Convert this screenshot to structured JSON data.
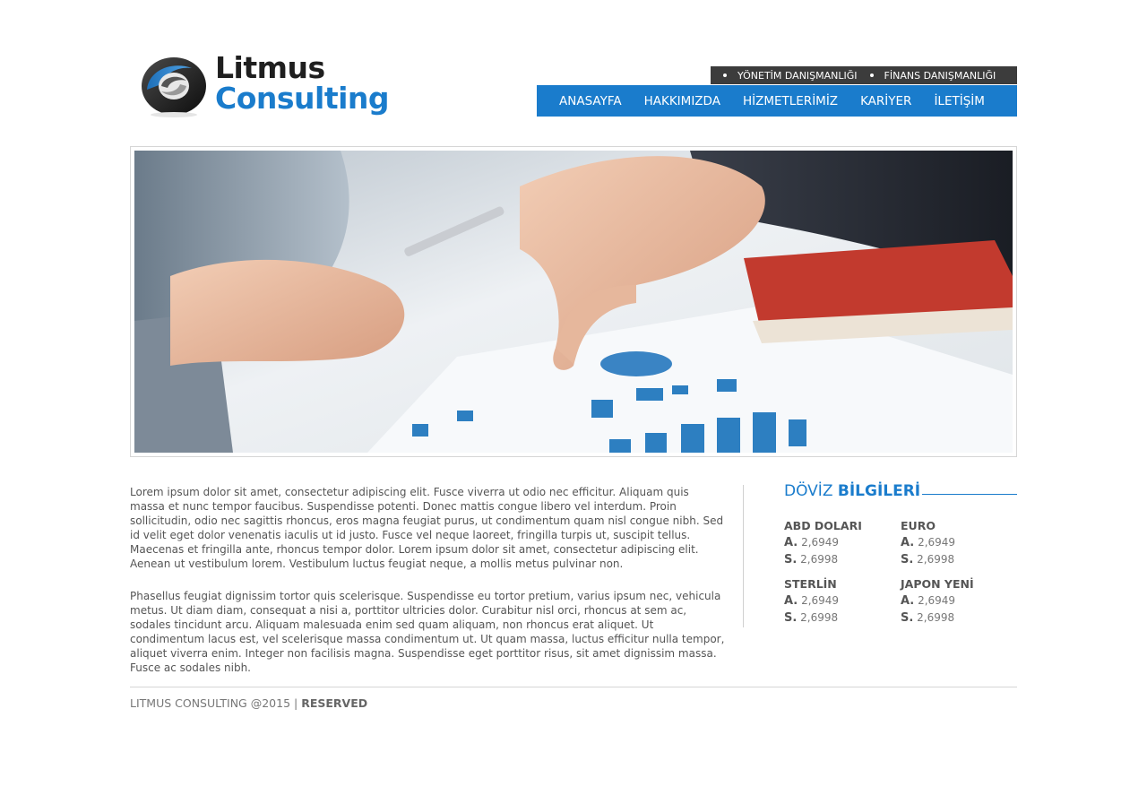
{
  "brand": {
    "line1": "Litmus",
    "line2": "Consulting",
    "colors": {
      "primary": "#1a7ccc",
      "dark": "#3c3c3c"
    }
  },
  "subnav": {
    "items": [
      {
        "label": "YÖNETİM DANIŞMANLIĞI"
      },
      {
        "label": "FİNANS DANIŞMANLIĞI"
      }
    ]
  },
  "mainnav": {
    "items": [
      {
        "label": "ANASAYFA"
      },
      {
        "label": "HAKKIMIZDA"
      },
      {
        "label": "HİZMETLERİMİZ"
      },
      {
        "label": "KARİYER"
      },
      {
        "label": "İLETİŞİM"
      }
    ]
  },
  "content": {
    "paragraphs": [
      "Lorem ipsum dolor sit amet, consectetur adipiscing elit. Fusce viverra ut odio nec efficitur. Aliquam quis massa et nunc tempor faucibus. Suspendisse potenti. Donec mattis congue libero vel interdum. Proin sollicitudin, odio nec sagittis rhoncus, eros magna feugiat purus, ut condimentum quam nisl congue nibh. Sed id velit eget dolor venenatis iaculis ut id justo. Fusce vel neque laoreet, fringilla turpis ut, suscipit tellus. Maecenas et fringilla ante, rhoncus tempor dolor. Lorem ipsum dolor sit amet, consectetur adipiscing elit. Aenean ut vestibulum lorem. Vestibulum luctus feugiat neque, a mollis metus pulvinar non.",
      "Phasellus feugiat dignissim tortor quis scelerisque. Suspendisse eu tortor pretium, varius ipsum nec, vehicula metus. Ut diam diam, consequat a nisi a, porttitor ultricies dolor. Curabitur nisl orci, rhoncus at sem ac, sodales tincidunt arcu. Aliquam malesuada enim sed quam aliquam, non rhoncus erat aliquet. Ut condimentum lacus est, vel scelerisque massa condimentum ut. Ut quam massa, luctus efficitur nulla tempor, aliquet viverra enim. Integer non facilisis magna. Suspendisse eget porttitor risus, sit amet dignissim massa. Fusce ac sodales nibh."
    ]
  },
  "currency": {
    "title_part1": "DÖVİZ",
    "title_part2": "BİLGİLERİ",
    "buy_label": "A.",
    "sell_label": "S.",
    "items": [
      {
        "name": "ABD DOLARI",
        "buy": "2,6949",
        "sell": "2,6998"
      },
      {
        "name": "EURO",
        "buy": "2,6949",
        "sell": "2,6998"
      },
      {
        "name": "STERLİN",
        "buy": "2,6949",
        "sell": "2,6998"
      },
      {
        "name": "JAPON YENİ",
        "buy": "2,6949",
        "sell": "2,6998"
      }
    ]
  },
  "footer": {
    "copyright": "LITMUS CONSULTING @2015 |",
    "reserved": "RESERVED"
  }
}
